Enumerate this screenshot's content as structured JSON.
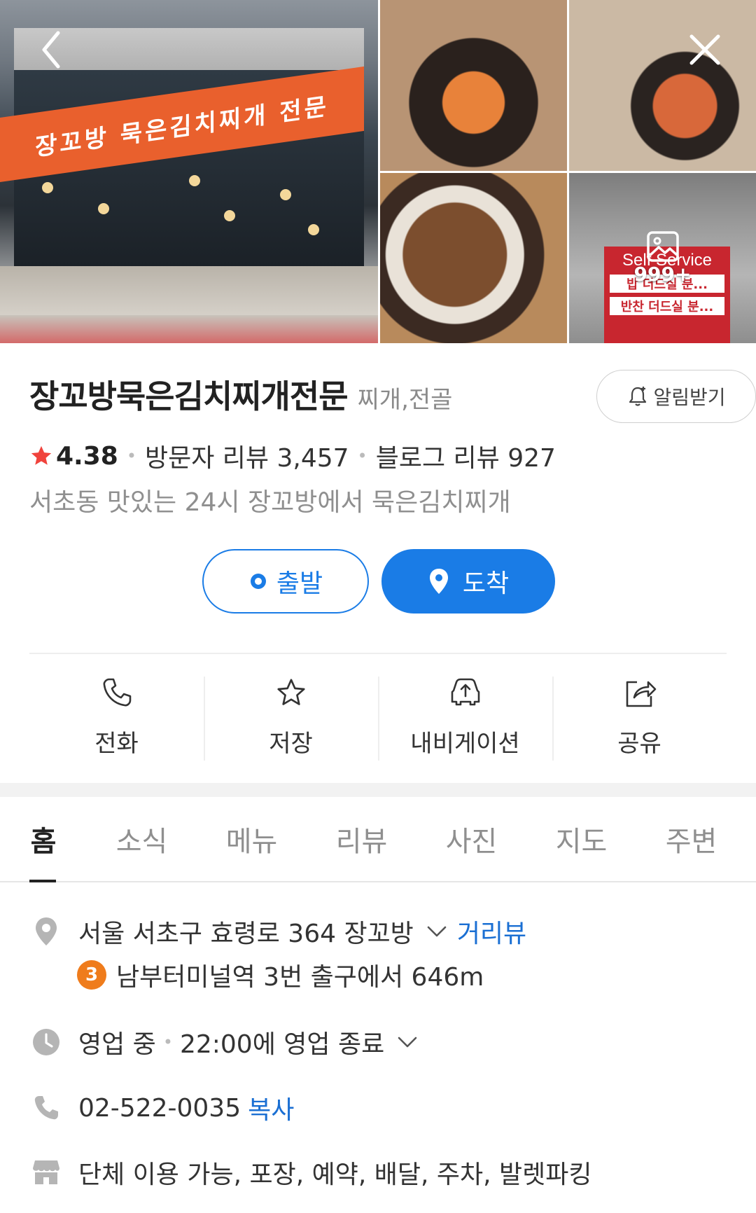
{
  "photos": {
    "main_sign_text": "장꼬방 묵은김치찌개 전문",
    "self_service_title": "Self Service",
    "self_service_line1": "밥  더드실 분...",
    "self_service_line2": "반찬 더드실 분...",
    "more_count": "999+"
  },
  "place": {
    "name": "장꼬방묵은김치찌개전문",
    "category": "찌개,전골",
    "alarm_label": "알림받기",
    "rating": "4.38",
    "visitor_reviews": "방문자 리뷰 3,457",
    "blog_reviews": "블로그 리뷰 927",
    "summary": "서초동 맛있는 24시 장꼬방에서 묵은김치찌개"
  },
  "route": {
    "start_label": "출발",
    "end_label": "도착"
  },
  "actions": [
    {
      "label": "전화",
      "icon": "phone-icon"
    },
    {
      "label": "저장",
      "icon": "star-icon"
    },
    {
      "label": "내비게이션",
      "icon": "car-navigation-icon"
    },
    {
      "label": "공유",
      "icon": "share-icon"
    }
  ],
  "tabs": [
    "홈",
    "소식",
    "메뉴",
    "리뷰",
    "사진",
    "지도",
    "주변"
  ],
  "details": {
    "address": "서울 서초구 효령로 364 장꼬방",
    "street_view": "거리뷰",
    "subway_line": "3",
    "subway_text": "남부터미널역 3번 출구에서 646m",
    "status": "영업 중",
    "hours": "22:00에 영업 종료",
    "phone": "02-522-0035",
    "copy_label": "복사",
    "amenities": "단체 이용 가능, 포장, 예약, 배달, 주차, 발렛파킹"
  },
  "colors": {
    "accent": "#1a7ce6",
    "star": "#f0433c",
    "subway_line_3": "#ef7c1c"
  }
}
